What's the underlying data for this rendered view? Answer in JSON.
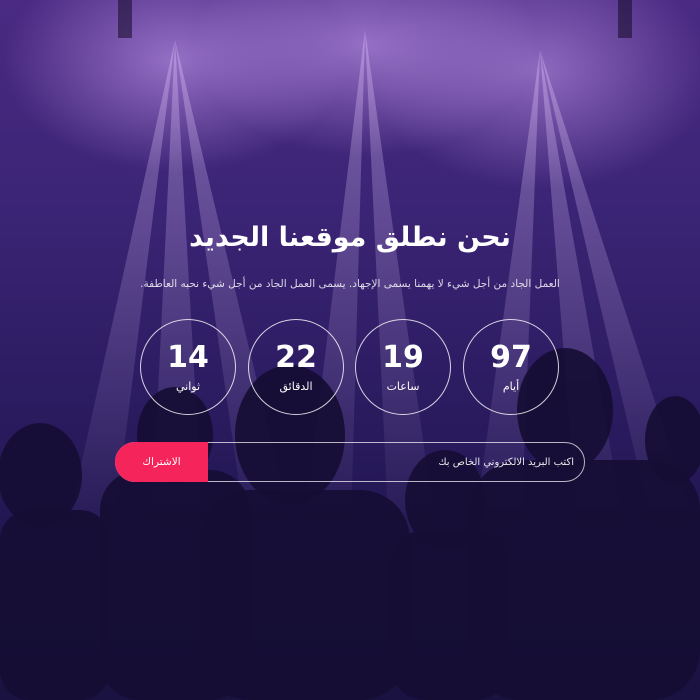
{
  "hero": {
    "title": "نحن نطلق موقعنا الجديد",
    "subtitle": "العمل الجاد من أجل شيء لا يهمنا يسمى الإجهاد. يسمى العمل الجاد من أجل شيء نحبه العاطفة."
  },
  "countdown": {
    "days": {
      "value": "97",
      "label": "أيام"
    },
    "hours": {
      "value": "19",
      "label": "ساعات"
    },
    "minutes": {
      "value": "22",
      "label": "الدقائق"
    },
    "seconds": {
      "value": "14",
      "label": "ثواني"
    }
  },
  "subscribe": {
    "placeholder": "اكتب البريد الالكتروني الخاص بك",
    "button_label": "الاشتراك"
  },
  "colors": {
    "accent": "#f5245a",
    "background_top": "#4a2a82",
    "background_bottom": "#1a1240"
  }
}
